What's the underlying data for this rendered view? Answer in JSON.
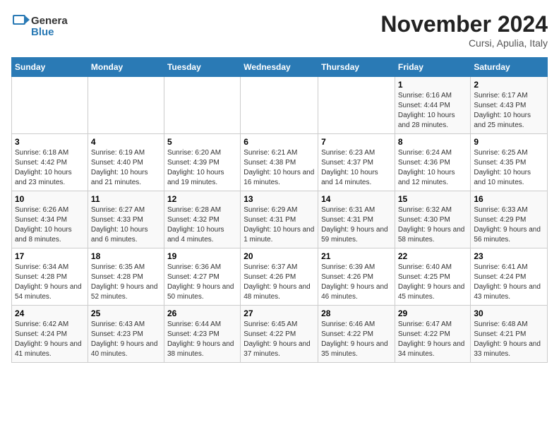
{
  "header": {
    "logo_general": "General",
    "logo_blue": "Blue",
    "month_title": "November 2024",
    "location": "Cursi, Apulia, Italy"
  },
  "days_of_week": [
    "Sunday",
    "Monday",
    "Tuesday",
    "Wednesday",
    "Thursday",
    "Friday",
    "Saturday"
  ],
  "weeks": [
    [
      {
        "day": "",
        "info": ""
      },
      {
        "day": "",
        "info": ""
      },
      {
        "day": "",
        "info": ""
      },
      {
        "day": "",
        "info": ""
      },
      {
        "day": "",
        "info": ""
      },
      {
        "day": "1",
        "info": "Sunrise: 6:16 AM\nSunset: 4:44 PM\nDaylight: 10 hours and 28 minutes."
      },
      {
        "day": "2",
        "info": "Sunrise: 6:17 AM\nSunset: 4:43 PM\nDaylight: 10 hours and 25 minutes."
      }
    ],
    [
      {
        "day": "3",
        "info": "Sunrise: 6:18 AM\nSunset: 4:42 PM\nDaylight: 10 hours and 23 minutes."
      },
      {
        "day": "4",
        "info": "Sunrise: 6:19 AM\nSunset: 4:40 PM\nDaylight: 10 hours and 21 minutes."
      },
      {
        "day": "5",
        "info": "Sunrise: 6:20 AM\nSunset: 4:39 PM\nDaylight: 10 hours and 19 minutes."
      },
      {
        "day": "6",
        "info": "Sunrise: 6:21 AM\nSunset: 4:38 PM\nDaylight: 10 hours and 16 minutes."
      },
      {
        "day": "7",
        "info": "Sunrise: 6:23 AM\nSunset: 4:37 PM\nDaylight: 10 hours and 14 minutes."
      },
      {
        "day": "8",
        "info": "Sunrise: 6:24 AM\nSunset: 4:36 PM\nDaylight: 10 hours and 12 minutes."
      },
      {
        "day": "9",
        "info": "Sunrise: 6:25 AM\nSunset: 4:35 PM\nDaylight: 10 hours and 10 minutes."
      }
    ],
    [
      {
        "day": "10",
        "info": "Sunrise: 6:26 AM\nSunset: 4:34 PM\nDaylight: 10 hours and 8 minutes."
      },
      {
        "day": "11",
        "info": "Sunrise: 6:27 AM\nSunset: 4:33 PM\nDaylight: 10 hours and 6 minutes."
      },
      {
        "day": "12",
        "info": "Sunrise: 6:28 AM\nSunset: 4:32 PM\nDaylight: 10 hours and 4 minutes."
      },
      {
        "day": "13",
        "info": "Sunrise: 6:29 AM\nSunset: 4:31 PM\nDaylight: 10 hours and 1 minute."
      },
      {
        "day": "14",
        "info": "Sunrise: 6:31 AM\nSunset: 4:31 PM\nDaylight: 9 hours and 59 minutes."
      },
      {
        "day": "15",
        "info": "Sunrise: 6:32 AM\nSunset: 4:30 PM\nDaylight: 9 hours and 58 minutes."
      },
      {
        "day": "16",
        "info": "Sunrise: 6:33 AM\nSunset: 4:29 PM\nDaylight: 9 hours and 56 minutes."
      }
    ],
    [
      {
        "day": "17",
        "info": "Sunrise: 6:34 AM\nSunset: 4:28 PM\nDaylight: 9 hours and 54 minutes."
      },
      {
        "day": "18",
        "info": "Sunrise: 6:35 AM\nSunset: 4:28 PM\nDaylight: 9 hours and 52 minutes."
      },
      {
        "day": "19",
        "info": "Sunrise: 6:36 AM\nSunset: 4:27 PM\nDaylight: 9 hours and 50 minutes."
      },
      {
        "day": "20",
        "info": "Sunrise: 6:37 AM\nSunset: 4:26 PM\nDaylight: 9 hours and 48 minutes."
      },
      {
        "day": "21",
        "info": "Sunrise: 6:39 AM\nSunset: 4:26 PM\nDaylight: 9 hours and 46 minutes."
      },
      {
        "day": "22",
        "info": "Sunrise: 6:40 AM\nSunset: 4:25 PM\nDaylight: 9 hours and 45 minutes."
      },
      {
        "day": "23",
        "info": "Sunrise: 6:41 AM\nSunset: 4:24 PM\nDaylight: 9 hours and 43 minutes."
      }
    ],
    [
      {
        "day": "24",
        "info": "Sunrise: 6:42 AM\nSunset: 4:24 PM\nDaylight: 9 hours and 41 minutes."
      },
      {
        "day": "25",
        "info": "Sunrise: 6:43 AM\nSunset: 4:23 PM\nDaylight: 9 hours and 40 minutes."
      },
      {
        "day": "26",
        "info": "Sunrise: 6:44 AM\nSunset: 4:23 PM\nDaylight: 9 hours and 38 minutes."
      },
      {
        "day": "27",
        "info": "Sunrise: 6:45 AM\nSunset: 4:22 PM\nDaylight: 9 hours and 37 minutes."
      },
      {
        "day": "28",
        "info": "Sunrise: 6:46 AM\nSunset: 4:22 PM\nDaylight: 9 hours and 35 minutes."
      },
      {
        "day": "29",
        "info": "Sunrise: 6:47 AM\nSunset: 4:22 PM\nDaylight: 9 hours and 34 minutes."
      },
      {
        "day": "30",
        "info": "Sunrise: 6:48 AM\nSunset: 4:21 PM\nDaylight: 9 hours and 33 minutes."
      }
    ]
  ]
}
